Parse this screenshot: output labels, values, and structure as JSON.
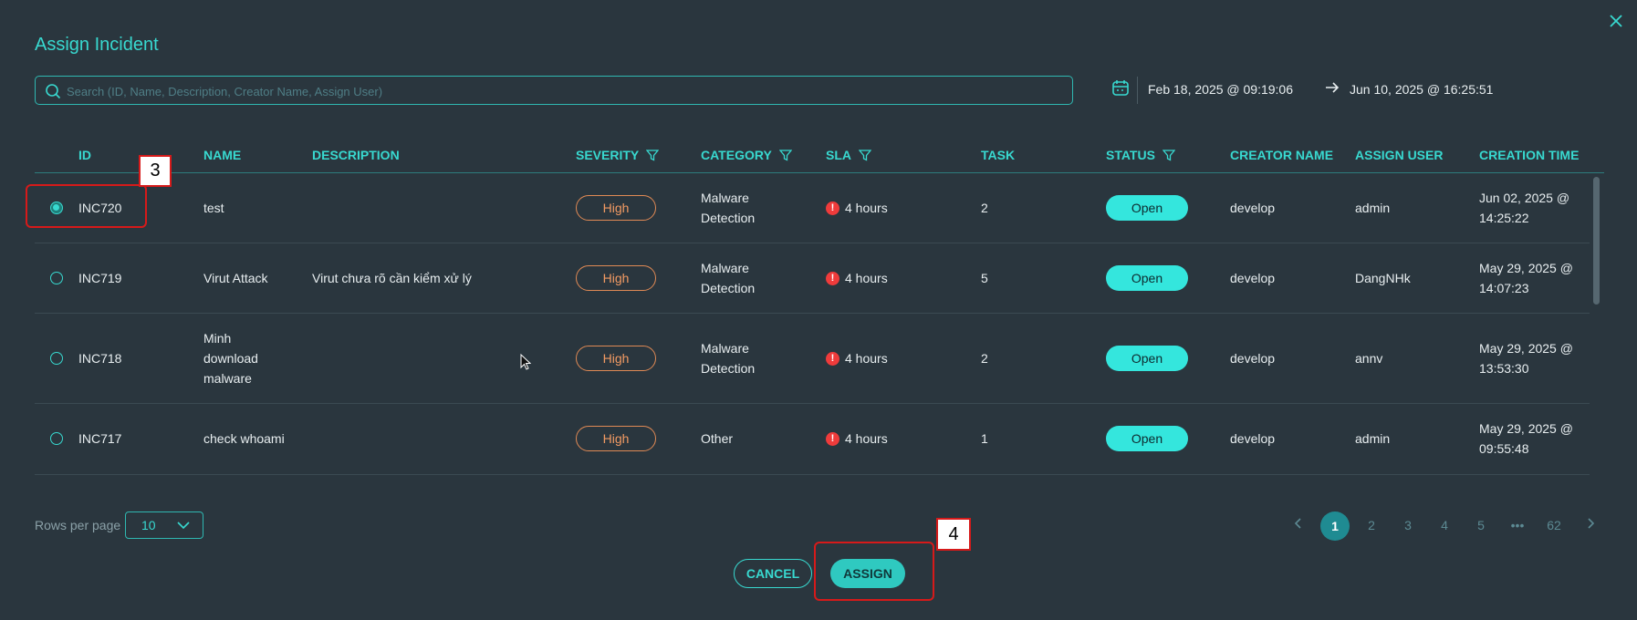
{
  "dialog": {
    "title": "Assign Incident",
    "search_placeholder": "Search (ID, Name, Description, Creator Name, Assign User)",
    "date_from": "Feb 18, 2025 @ 09:19:06",
    "date_to": "Jun 10, 2025 @ 16:25:51"
  },
  "table": {
    "columns": [
      "ID",
      "NAME",
      "DESCRIPTION",
      "SEVERITY",
      "CATEGORY",
      "SLA",
      "TASK",
      "STATUS",
      "CREATOR NAME",
      "ASSIGN USER",
      "CREATION TIME"
    ],
    "rows": [
      {
        "selected": true,
        "id": "INC720",
        "name": [
          "test"
        ],
        "description": "",
        "severity": "High",
        "category": [
          "Malware",
          "Detection"
        ],
        "sla": "4 hours",
        "task": "2",
        "status": "Open",
        "creator": "develop",
        "assign_user": "admin",
        "creation_time": [
          "Jun 02, 2025 @",
          "14:25:22"
        ]
      },
      {
        "selected": false,
        "id": "INC719",
        "name": [
          "Virut Attack"
        ],
        "description": "Virut chưa rõ cần kiểm xử lý",
        "severity": "High",
        "category": [
          "Malware",
          "Detection"
        ],
        "sla": "4 hours",
        "task": "5",
        "status": "Open",
        "creator": "develop",
        "assign_user": "DangNHk",
        "creation_time": [
          "May 29, 2025 @",
          "14:07:23"
        ]
      },
      {
        "selected": false,
        "id": "INC718",
        "name": [
          "Minh",
          "download",
          "malware"
        ],
        "description": "",
        "severity": "High",
        "category": [
          "Malware",
          "Detection"
        ],
        "sla": "4 hours",
        "task": "2",
        "status": "Open",
        "creator": "develop",
        "assign_user": "annv",
        "creation_time": [
          "May 29, 2025 @",
          "13:53:30"
        ]
      },
      {
        "selected": false,
        "id": "INC717",
        "name": [
          "check whoami"
        ],
        "description": "",
        "severity": "High",
        "category": [
          "Other"
        ],
        "sla": "4 hours",
        "task": "1",
        "status": "Open",
        "creator": "develop",
        "assign_user": "admin",
        "creation_time": [
          "May 29, 2025 @",
          "09:55:48"
        ]
      }
    ]
  },
  "footer": {
    "rows_per_page_label": "Rows per page",
    "rows_per_page_value": "10",
    "pages": [
      "1",
      "2",
      "3",
      "4",
      "5",
      "•••",
      "62"
    ],
    "current_page": "1",
    "cancel_label": "CANCEL",
    "assign_label": "ASSIGN"
  },
  "annotations": {
    "marker_3": "3",
    "marker_4": "4"
  },
  "colors": {
    "background": "#2a363e",
    "accent": "#38d9d0",
    "severity_high": "#f29a63",
    "sla_alert": "#ef3b3b",
    "status_open": "#34e6dd",
    "highlight": "#d61a1a"
  }
}
